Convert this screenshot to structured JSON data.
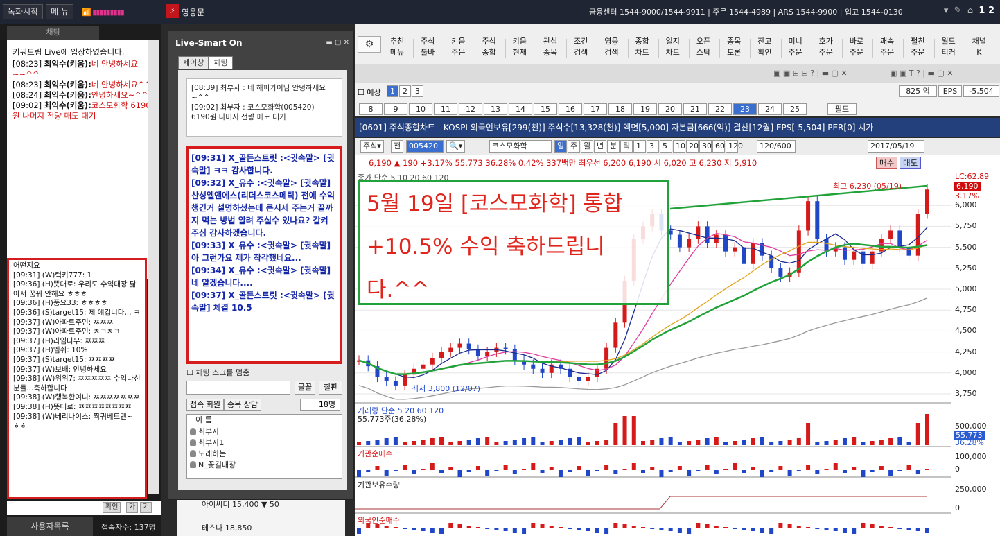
{
  "topbar": {
    "record_btn": "녹화시작",
    "menu_btn": "메 뉴",
    "signal": "▮▮▮▮▮▮▮▮▮",
    "app_title": "영웅문",
    "info": "금융센터 1544-9000/1544-9911 | 주문 1544-4989 | ARS 1544-9900 | 입고 1544-0130",
    "page_num": "1 2"
  },
  "left": {
    "header": "채팅",
    "chat1": [
      {
        "sys": "키워드림 Live에 입장하였습니다."
      },
      {
        "t": "[08:23]",
        "u": "최익수(키움):",
        "m": "네 안녕하세요~~^^"
      },
      {
        "t": "[08:23]",
        "u": "최익수(키움):",
        "m": "네 안녕하세요^^"
      },
      {
        "t": "[08:24]",
        "u": "최익수(키움):",
        "m": "안녕하세요~^^"
      },
      {
        "t": "[09:02]",
        "u": "최익수(키움):",
        "m": "코스모화학 6190원 나머지 전량 매도 대기"
      }
    ],
    "chat2": [
      "어떤지요",
      "[09:31] (W)럭키777: 1",
      "[09:36] (H)뜻대로: 우리도 수익대장 닮아서 꿈꿔 안해요 ㅎㅎㅎ",
      "[09:36] (H)풍요33: ㅎㅎㅎㅎ",
      "[09:36] (S)target15: 제 얘깁니다,,, ㅋ",
      "[09:37] (W)아파트주민: ㅉㅉㅉ",
      "[09:37] (W)아파트주민: ㅊㅋㅊㅋ",
      "[09:37] (H)라임나무: ㅉㅉㅉ",
      "[09:37] (H)엠쉬: 10%",
      "[09:37] (S)target15: ㅉㅉㅉㅉ",
      "[09:37] (W)보배: 안녕하세요",
      "[09:38] (W)위위7: ㅉㅉㅉㅉㅉ 수익나신분들...축하합니다",
      "[09:38] (W)행복한여니: ㅉㅉㅉㅉㅉㅉㅉ",
      "[09:38] (H)뜻대로: ㅉㅉㅉㅉㅉㅉㅉㅉ",
      "[09:38] (W)베리나이스: 짝귀베트맨~ ㅎㅎ"
    ],
    "btn_confirm": "확인",
    "btn_ga": "가",
    "btn_gi": "기",
    "users_btn": "사용자목록",
    "conn_count": "접속자수: 137명"
  },
  "popup": {
    "title": "Live-Smart On",
    "tabs": [
      "제어창",
      "채팅"
    ],
    "box1": [
      "[08:39] 최부자 : 네 해피가이님 안녕하세요~^^",
      "[09:02] 최부자 : 코스모화학(005420) 6190원 나머지 전량 매도 대기"
    ],
    "box2": [
      "[09:31] X_골든스트릿 :<귓속말> [귓속말] ㅋㅋ 감사합니다.",
      "[09:32] X_유수 :<귓속말> [귓속말] 산성엘앤에스(리더스코스메틱) 전에 수익챙긴거 설명하셨는데 큰시세 주는거 끝까지 먹는 방법 알려 주실수 있나요? 갈켜 주심 감사하겠습니다.",
      "[09:33] X_유수 :<귓속말> [귓속말] 아 그런가요 제가 착각했네요...",
      "[09:34] X_유수 :<귓속말> [귓속말] 네 알겠습니다....",
      "[09:37] X_골든스트릿 :<귓속말> [귓속말] 체결 10.5"
    ],
    "scroll_stop": "채팅 스크롤 멈춤",
    "font_btn": "글꼴",
    "board_btn": "칠판",
    "subtabs": [
      "접속 회원",
      "종목 상담"
    ],
    "people": "18명",
    "list_header": "이 름",
    "members": [
      "최부자",
      "최부자1",
      "노래하는",
      "N_꽃길대장"
    ]
  },
  "under": {
    "r1": "아이씨디    15,400  ▼   50",
    "r2": "테스나       18,850"
  },
  "toolbar": {
    "items": [
      "추천 메뉴",
      "주식 툴바",
      "키움 주문",
      "주식 종합",
      "키움 현재",
      "관심 종목",
      "조건 검색",
      "영웅 검색",
      "종합 차트",
      "일지 차트",
      "오픈 스탁",
      "종목 토론",
      "잔고 확인",
      "미니 주문",
      "호가 주문",
      "바로 주문",
      "쾌속 주문",
      "펄친 주문",
      "월드 티커",
      "채널 K"
    ]
  },
  "rows": {
    "predict": "예상",
    "row2_nums": [
      "1",
      "2",
      "3"
    ],
    "row3_nums": [
      "8",
      "9",
      "10",
      "11",
      "12",
      "13",
      "14",
      "15",
      "16",
      "17",
      "18",
      "19",
      "20",
      "21",
      "22",
      "23",
      "24",
      "25"
    ],
    "selected": "23",
    "field_btn": "필드",
    "eps_val": "825 억",
    "eps": "EPS",
    "eps_num": "-5,504"
  },
  "chart": {
    "header": "[0601] 주식종합차트 - KOSPI 외국인보유[299(천)] 주식수[13,328(천)] 액면[5,000] 자본금[666(억)] 결산[12월] EPS[-5,504] PER[0] 시가",
    "code": "005420",
    "name": "코스모화학",
    "periods": [
      "일",
      "주",
      "월",
      "년",
      "분",
      "틱",
      "1",
      "3",
      "5",
      "10",
      "20",
      "30",
      "60",
      "120"
    ],
    "count": "120/600",
    "date": "2017/05/19",
    "quote": "6,190 ▲   190  +3.17%      55,773   36.28%  0.42%         337백만 최우선  6,200   6,190  시  6,020  고  6,230  저  5,910",
    "buy": "매수",
    "sell": "매도",
    "annotation": "5월 19일 [코스모화학] 통합 +10.5% 수익 축하드립니다.^^",
    "legend": "종가 단순 5  10  20  60  120",
    "high_label": "최고 6,230 (05/19)",
    "low_label": "최저 3,800 (12/07)",
    "lc_label": "LC:62.89",
    "price_tag": "6,190",
    "pct_tag": "3.17%",
    "price_ticks": [
      "6,000",
      "5,750",
      "5,500",
      "5,250",
      "5,000",
      "4,750",
      "4,500",
      "4,250",
      "4,000",
      "3,750"
    ],
    "vol_label": "거래량 단순 5  20  60  120",
    "vol_sub": "55,773주(36.28%)",
    "vol_ticks": [
      "500,000",
      "55,773",
      "36.28%"
    ],
    "inst_label": "기관순매수",
    "inst_ticks": [
      "100,000",
      "0"
    ],
    "instown_label": "기관보유수량",
    "instown_ticks": [
      "250,000",
      "0"
    ],
    "foreign_label": "외국인순매수"
  },
  "chart_data": {
    "type": "candlestick",
    "title": "코스모화학 (005420) 일봉",
    "x_range": [
      "2016-12",
      "2017-05-19"
    ],
    "ylim": [
      3750,
      6250
    ],
    "high": {
      "value": 6230,
      "date": "05/19"
    },
    "low": {
      "value": 3800,
      "date": "12/07"
    },
    "close_series": [
      4150,
      4080,
      3950,
      3900,
      3850,
      3980,
      4050,
      4100,
      4180,
      4250,
      4300,
      4350,
      4280,
      4200,
      4250,
      4300,
      4280,
      4150,
      4100,
      4050,
      4000,
      4100,
      4050,
      3950,
      3900,
      3950,
      4050,
      4300,
      4600,
      5100,
      5600,
      5750,
      5900,
      5700,
      5650,
      5500,
      5600,
      5750,
      5550,
      5650,
      5450,
      5500,
      5300,
      5550,
      5400,
      5250,
      5150,
      5200,
      5700,
      6050,
      5600,
      5450,
      5500,
      5350,
      5450,
      5300,
      5450,
      5600,
      5700,
      5500,
      5400,
      5900,
      6190
    ],
    "ma_series": [
      {
        "name": "5",
        "color": "#1b2a8f"
      },
      {
        "name": "10",
        "color": "#e23b9c"
      },
      {
        "name": "20",
        "color": "#e2a31b"
      },
      {
        "name": "60",
        "color": "#22a33a"
      },
      {
        "name": "120",
        "color": "#999999"
      }
    ]
  }
}
